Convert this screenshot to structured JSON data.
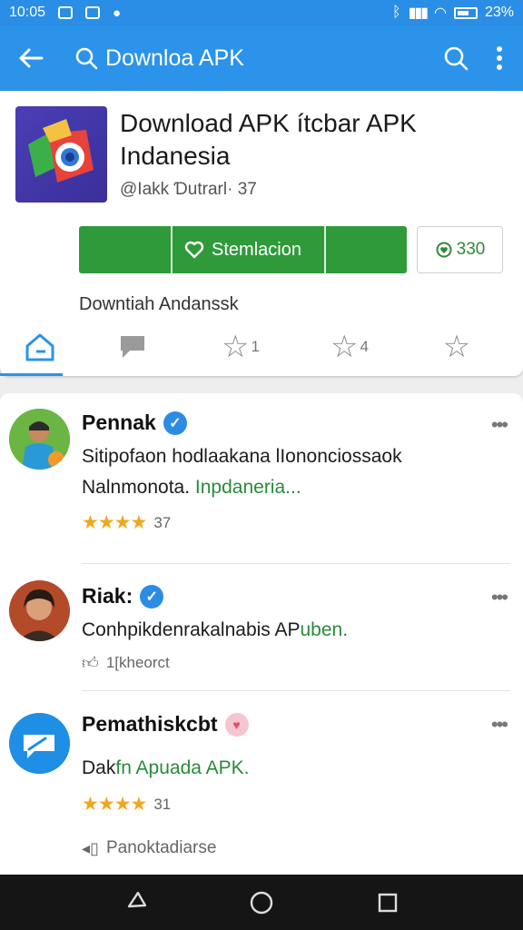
{
  "status_bar": {
    "time": "10:05",
    "battery_text": "23%"
  },
  "app_bar": {
    "search_text": "Downloa APK",
    "back_icon": "back-arrow-icon",
    "search_icon": "search-icon",
    "menu_icon": "more-vert-icon",
    "color": "#2b93ea"
  },
  "app": {
    "title": "Download APK ítcbar APK Indanesia",
    "subtitle": "@Iakk Ɗutrarl· 37",
    "install_label": "Stemlacion",
    "like_count": "330",
    "description": "Downtiah Andanssk",
    "install_color": "#2f9a3a"
  },
  "tabs": [
    {
      "icon": "home-icon",
      "label": ""
    },
    {
      "icon": "chat-flag-icon",
      "label": ""
    },
    {
      "icon": "star-outline-icon",
      "label": "1"
    },
    {
      "icon": "star-outline-icon",
      "label": "4"
    },
    {
      "icon": "star-outline-icon",
      "label": ""
    }
  ],
  "comments": [
    {
      "name": "Pennak",
      "badge": "verified",
      "text_main": "Sitipofaon hodlaakana lIononciossaok Nalnmonota. ",
      "text_green": "Inpdaneria...",
      "rating": "★★★★",
      "count": "37",
      "more": "•••"
    },
    {
      "name": "Riak:",
      "badge": "verified",
      "text_main": "Conhpikdenrakalnabis AP",
      "text_green": "uben.",
      "meta": "1[kheorct",
      "more": "•••"
    },
    {
      "name": "Pemathiskcbt",
      "badge": "heart",
      "text_main": "Dak",
      "text_green": "fn Apuada APK.",
      "rating": "★★★★",
      "count": "31",
      "reply": "Panoktadiarse",
      "more": "•••"
    }
  ]
}
